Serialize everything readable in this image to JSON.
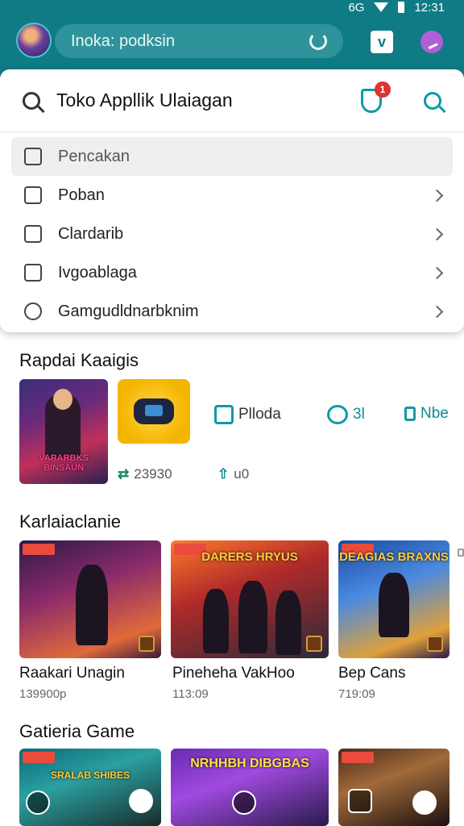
{
  "status": {
    "network": "6G",
    "time": "12:31"
  },
  "header": {
    "search_label": "Inoka: podksin",
    "button_v_label": "v"
  },
  "store": {
    "title": "Toko Appllik Ulaiagan",
    "notification_count": "1"
  },
  "menu": {
    "items": [
      {
        "label": "Pencakan",
        "icon": "calendar-icon"
      },
      {
        "label": "Poban",
        "icon": "thumb-up-icon"
      },
      {
        "label": "Clardarib",
        "icon": "check-box-icon"
      },
      {
        "label": "Ivgoablaga",
        "icon": "y-box-icon"
      },
      {
        "label": "Gamgudldnarbknim",
        "icon": "search-circle-icon"
      }
    ]
  },
  "featured": {
    "section_title": "Rapdai Kaaigis",
    "image_text": "VARARBKS BINSAUN",
    "chips": [
      {
        "label": "Plloda",
        "icon": "p-box-icon"
      },
      {
        "label": "3l",
        "icon": "chat-bubble-icon"
      },
      {
        "label": "Nbe",
        "icon": "b-box-icon"
      }
    ],
    "downloads": "23930",
    "rating": "u0"
  },
  "section2": {
    "title": "Karlaiaclanie",
    "games": [
      {
        "name": "Raakari Unagin",
        "size": "139900p",
        "logo": ""
      },
      {
        "name": "Pineheha VakHoo",
        "size": "113:09",
        "logo": "DARERS HRYUS"
      },
      {
        "name": "Bep Cans",
        "size": "719:09",
        "logo": "DEAGIAS BRAXNS"
      }
    ]
  },
  "section3": {
    "title": "Gatieria Game",
    "games": [
      {
        "logo": "SRALAB SHIBES"
      },
      {
        "logo": "NRHHBH DIBGBAS"
      },
      {
        "logo": ""
      }
    ]
  },
  "colors": {
    "header": "#0f7c85",
    "accent": "#0f9aa2",
    "badge": "#e0322e"
  }
}
